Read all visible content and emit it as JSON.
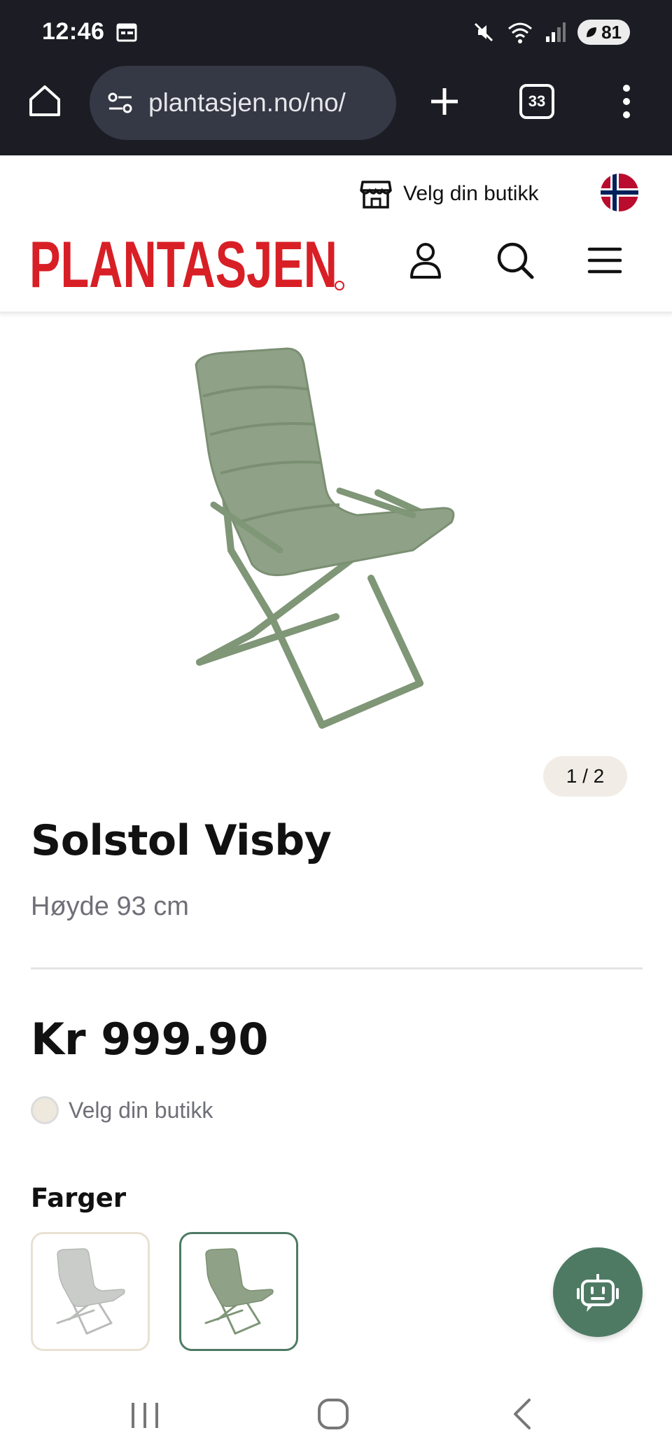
{
  "status_bar": {
    "time": "12:46",
    "battery": "81",
    "icons": [
      "calendar-icon",
      "mute-icon",
      "wifi-icon",
      "signal-icon",
      "battery-icon"
    ]
  },
  "browser": {
    "url": "plantasjen.no/no/",
    "tab_count": "33",
    "icons": [
      "home-icon",
      "site-settings-icon",
      "new-tab-icon",
      "more-icon"
    ]
  },
  "header": {
    "store_label": "Velg din butikk",
    "logo_text": "PLANTASJEN",
    "icons": [
      "store-icon",
      "norway-flag-icon",
      "account-icon",
      "search-icon",
      "hamburger-icon"
    ]
  },
  "product": {
    "image_counter": "1 / 2",
    "title": "Solstol Visby",
    "subtitle": "Høyde 93 cm",
    "price": "Kr 999.90",
    "stock_label": "Velg din butikk",
    "colors_heading": "Farger",
    "swatches": [
      {
        "name": "light-grey",
        "color": "#c9ccc9"
      },
      {
        "name": "green",
        "color": "#8fa287"
      }
    ]
  },
  "colors": {
    "brand_red": "#d81f26",
    "brand_green": "#4e7a64",
    "chair_green": "#8fa287",
    "chair_grey": "#c9ccc9"
  },
  "nav": {
    "icons": [
      "recent-apps-icon",
      "home-nav-icon",
      "back-icon"
    ]
  }
}
